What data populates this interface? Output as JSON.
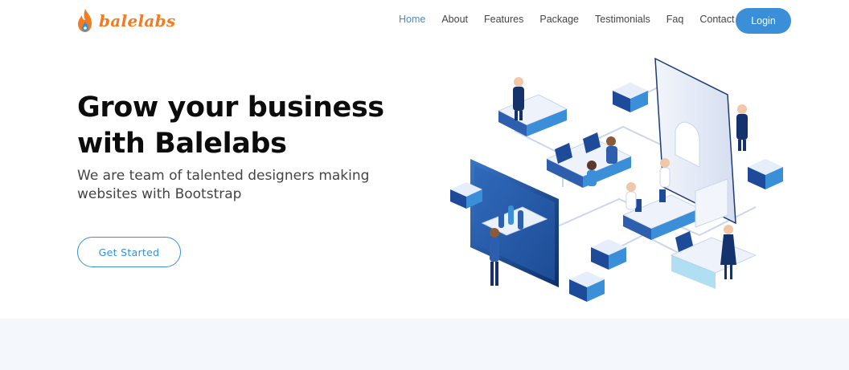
{
  "brand": {
    "name": "balelabs",
    "logo_icon": "flame-icon",
    "color": "#f47b20"
  },
  "nav": {
    "items": [
      {
        "label": "Home",
        "active": true
      },
      {
        "label": "About"
      },
      {
        "label": "Features"
      },
      {
        "label": "Package"
      },
      {
        "label": "Testimonials"
      },
      {
        "label": "Faq"
      },
      {
        "label": "Contact"
      }
    ],
    "login_label": "Login"
  },
  "hero": {
    "title": "Grow your business with Balelabs",
    "subtitle": "We are team of talented designers making websites with Bootstrap",
    "cta_label": "Get Started"
  },
  "colors": {
    "accent": "#3b8fd9",
    "band": "#f4f8fc"
  }
}
